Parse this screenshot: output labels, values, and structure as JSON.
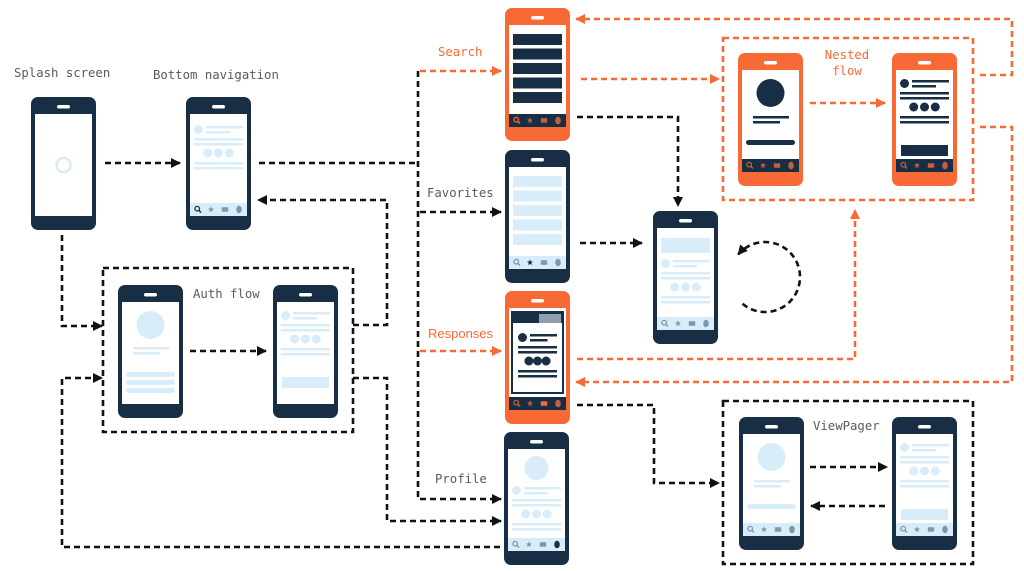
{
  "colors": {
    "primary": "#172E45",
    "accent": "#F86A35",
    "placeholder": "#D8ECFA",
    "label_text": "#5A5A5A",
    "connector": "#111111",
    "muted_tab": "#8E9FAE",
    "nav_icon_light": "#7E97AE",
    "nav_icon_dark": "#C4603A",
    "screen": "#FFFFFF"
  },
  "labels": {
    "splash_screen": "Splash screen",
    "bottom_navigation": "Bottom navigation",
    "search": "Search",
    "favorites": "Favorites",
    "responses": "Responses",
    "profile": "Profile",
    "auth_flow": "Auth flow",
    "nested_flow_lines": [
      "Nested",
      "flow"
    ],
    "view_pager": "ViewPager"
  },
  "nav_icons": [
    "search-icon",
    "star-icon",
    "mail-icon",
    "profile-icon"
  ],
  "screens": [
    {
      "id": "splash",
      "theme": "dark",
      "content": "spinner",
      "nav": "none"
    },
    {
      "id": "bottom-navigation",
      "theme": "dark",
      "content": "feed",
      "nav": "light",
      "active": "search-icon"
    },
    {
      "id": "search",
      "theme": "accent",
      "content": "list-dark",
      "nav": "dark",
      "active": "search-icon"
    },
    {
      "id": "favorites",
      "theme": "dark",
      "content": "list-light",
      "nav": "light",
      "active": "star-icon"
    },
    {
      "id": "responses",
      "theme": "accent",
      "content": "card-with-tabs",
      "nav": "dark",
      "active": "mail-icon"
    },
    {
      "id": "profile",
      "theme": "dark",
      "content": "profile-feed",
      "nav": "light",
      "active": "profile-icon"
    },
    {
      "id": "detail",
      "theme": "dark",
      "content": "banner-feed",
      "nav": "light",
      "active": null
    },
    {
      "id": "auth-login",
      "theme": "dark",
      "content": "login-form",
      "nav": "none"
    },
    {
      "id": "auth-feed",
      "theme": "dark",
      "content": "feed-button",
      "nav": "none"
    },
    {
      "id": "nested-profile",
      "theme": "accent",
      "content": "profile-pill",
      "nav": "dark",
      "active": null
    },
    {
      "id": "nested-detail",
      "theme": "accent",
      "content": "feed-button",
      "nav": "dark",
      "active": null
    },
    {
      "id": "pager-page-1",
      "theme": "dark",
      "content": "profile-pill",
      "nav": "light",
      "active": null
    },
    {
      "id": "pager-page-2",
      "theme": "dark",
      "content": "feed-button",
      "nav": "light",
      "active": null
    }
  ],
  "groups": [
    {
      "id": "auth-flow",
      "label_key": "auth_flow",
      "style": "black",
      "members": [
        "auth-login",
        "auth-feed"
      ]
    },
    {
      "id": "nested-flow",
      "label_key": "nested_flow_lines",
      "style": "orange",
      "members": [
        "nested-profile",
        "nested-detail"
      ]
    },
    {
      "id": "view-pager",
      "label_key": "view_pager",
      "style": "black",
      "members": [
        "pager-page-1",
        "pager-page-2"
      ]
    }
  ],
  "connections": [
    {
      "id": "splash-to-bottom-navigation",
      "from": "splash",
      "to": "bottom-navigation",
      "style": "black"
    },
    {
      "id": "bottom-navigation-trunk",
      "from": "bottom-navigation",
      "to": "tabs",
      "style": "black"
    },
    {
      "id": "tab-search",
      "from": "bottom-navigation",
      "to": "search",
      "style": "orange"
    },
    {
      "id": "tab-favorites",
      "from": "bottom-navigation",
      "to": "favorites",
      "style": "black"
    },
    {
      "id": "tab-responses",
      "from": "bottom-navigation",
      "to": "responses",
      "style": "orange"
    },
    {
      "id": "tab-profile",
      "from": "bottom-navigation",
      "to": "profile",
      "style": "black"
    },
    {
      "id": "auth-to-bottom-navigation",
      "from": "auth-flow",
      "to": "bottom-navigation",
      "style": "black"
    },
    {
      "id": "auth-to-profile",
      "from": "auth-flow",
      "to": "profile",
      "style": "black"
    },
    {
      "id": "splash-to-auth",
      "from": "splash",
      "to": "auth-flow",
      "style": "black"
    },
    {
      "id": "profile-to-auth",
      "from": "profile",
      "to": "auth-flow",
      "style": "black"
    },
    {
      "id": "auth-login-to-auth-feed",
      "from": "auth-login",
      "to": "auth-feed",
      "style": "black"
    },
    {
      "id": "search-to-detail",
      "from": "search",
      "to": "detail",
      "style": "black"
    },
    {
      "id": "favorites-to-detail",
      "from": "favorites",
      "to": "detail",
      "style": "black"
    },
    {
      "id": "detail-self-loop",
      "from": "detail",
      "to": "detail",
      "style": "black"
    },
    {
      "id": "responses-to-view-pager",
      "from": "responses",
      "to": "view-pager",
      "style": "black"
    },
    {
      "id": "pager-next",
      "from": "pager-page-1",
      "to": "pager-page-2",
      "style": "black"
    },
    {
      "id": "pager-prev",
      "from": "pager-page-2",
      "to": "pager-page-1",
      "style": "black"
    },
    {
      "id": "search-to-nested-flow",
      "from": "search",
      "to": "nested-flow",
      "style": "orange"
    },
    {
      "id": "nested-profile-to-nested-detail",
      "from": "nested-profile",
      "to": "nested-detail",
      "style": "orange"
    },
    {
      "id": "nested-flow-to-search",
      "from": "nested-flow",
      "to": "search",
      "style": "orange"
    },
    {
      "id": "nested-flow-to-responses",
      "from": "nested-flow",
      "to": "responses",
      "style": "orange"
    },
    {
      "id": "responses-to-nested-flow",
      "from": "responses",
      "to": "nested-flow",
      "style": "orange"
    }
  ]
}
